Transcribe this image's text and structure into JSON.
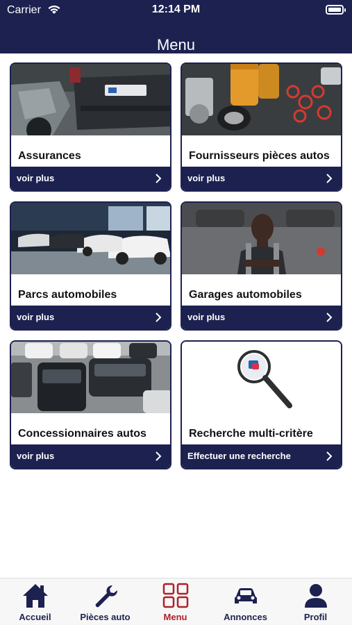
{
  "status": {
    "carrier": "Carrier",
    "time": "12:14 PM"
  },
  "header": {
    "title": "Menu"
  },
  "cards": [
    {
      "label": "Assurances",
      "action": "voir plus"
    },
    {
      "label": "Fournisseurs pièces autos",
      "action": "voir plus"
    },
    {
      "label": "Parcs automobiles",
      "action": "voir plus"
    },
    {
      "label": "Garages automobiles",
      "action": "voir plus"
    },
    {
      "label": "Concessionnaires autos",
      "action": "voir plus"
    },
    {
      "label": "Recherche multi-critère",
      "action": "Effectuer une recherche"
    }
  ],
  "tabs": [
    {
      "label": "Accueil",
      "icon": "home-icon"
    },
    {
      "label": "Pièces auto",
      "icon": "wrench-icon"
    },
    {
      "label": "Menu",
      "icon": "grid-icon",
      "active": true
    },
    {
      "label": "Annonces",
      "icon": "car-icon"
    },
    {
      "label": "Profil",
      "icon": "user-icon"
    }
  ],
  "colors": {
    "primary": "#1c2150",
    "active": "#b0202a",
    "background": "#ffffff"
  }
}
